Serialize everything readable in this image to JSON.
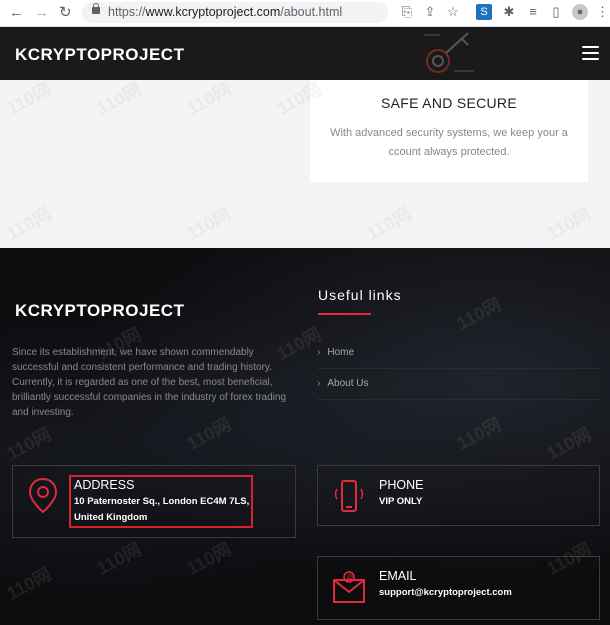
{
  "browser": {
    "url_scheme": "https://",
    "url_host": "www.kcryptoproject.com",
    "url_path": "/about.html"
  },
  "header": {
    "brand": "KCRYPTOPROJECT"
  },
  "feature_card": {
    "title": "SAFE AND SECURE",
    "description": "With advanced security systems, we keep your a ccount always protected."
  },
  "footer": {
    "brand": "KCRYPTOPROJECT",
    "about": "Since its establishment, we have shown commendably successful and consistent performance and trading history. Currently, it is regarded as one of the best, most beneficial, brilliantly successful companies in the industry of forex trading and investing.",
    "links_title": "Useful links",
    "links": [
      {
        "label": "Home"
      },
      {
        "label": "About Us"
      }
    ],
    "address": {
      "heading": "ADDRESS",
      "line1": "10 Paternoster Sq., London EC4M 7LS,",
      "line2": "United Kingdom"
    },
    "phone": {
      "heading": "PHONE",
      "value": "VIP ONLY"
    },
    "email": {
      "heading": "EMAIL",
      "value": "support@kcryptoproject.com"
    }
  },
  "watermark": "110网",
  "colors": {
    "accent_red": "#e02b3c",
    "dark_bg": "#0c0c0e",
    "header_bg": "#1a1a1a"
  }
}
